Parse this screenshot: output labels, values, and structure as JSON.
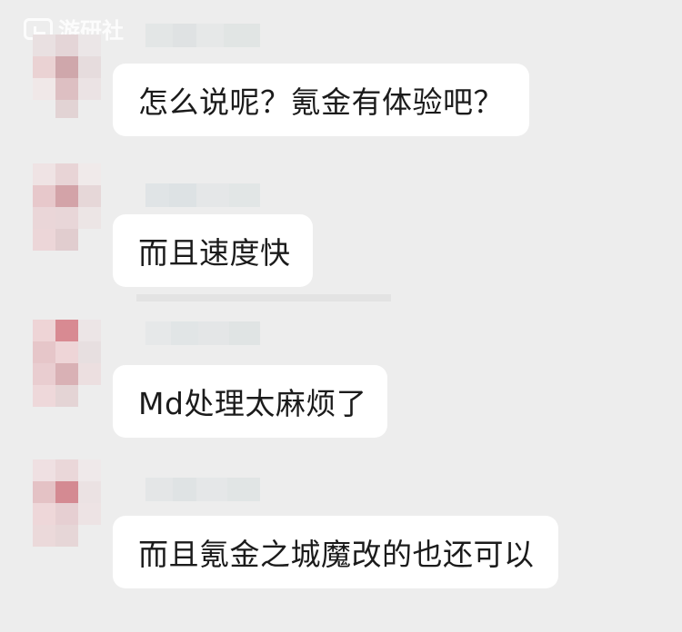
{
  "watermark": {
    "text": "游研社",
    "icon": "app-logo-icon"
  },
  "messages": [
    {
      "sender_name": "",
      "avatar": "pixelated-avatar",
      "text": "怎么说呢？氪金有体验吧？"
    },
    {
      "sender_name": "",
      "avatar": "pixelated-avatar",
      "text": "而且速度快"
    },
    {
      "sender_name": "",
      "avatar": "pixelated-avatar",
      "text": "Md处理太麻烦了"
    },
    {
      "sender_name": "",
      "avatar": "pixelated-avatar",
      "text": "而且氪金之城魔改的也还可以"
    }
  ],
  "colors": {
    "background": "#ededed",
    "bubble": "#ffffff",
    "text": "#1b1b1b"
  }
}
